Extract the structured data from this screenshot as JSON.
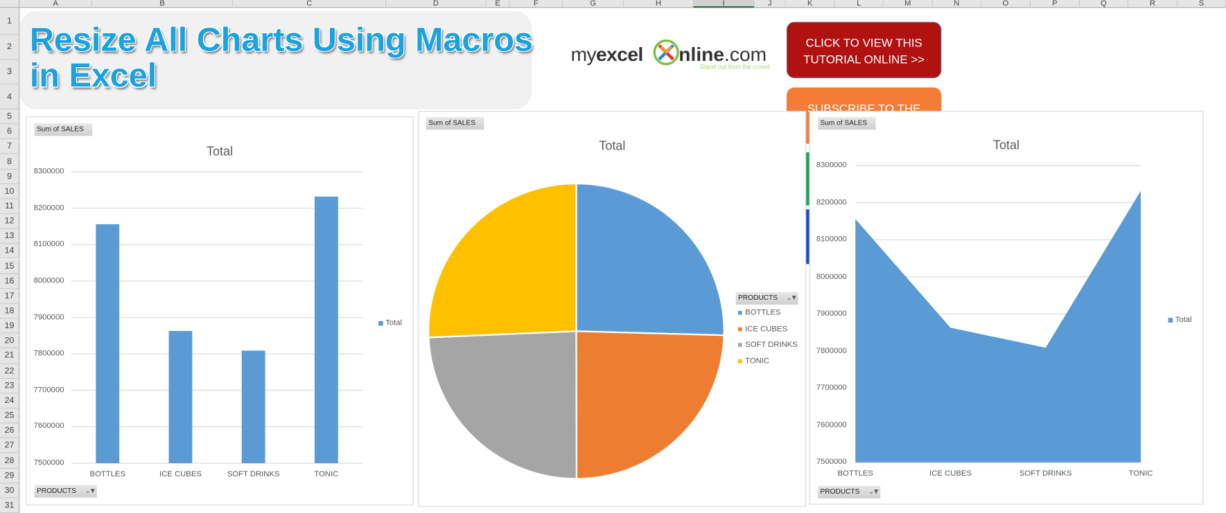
{
  "sheet": {
    "columns": [
      "A",
      "B",
      "C",
      "D",
      "E",
      "F",
      "G",
      "H",
      "I",
      "J",
      "K",
      "L",
      "M",
      "N",
      "O",
      "P",
      "Q",
      "R",
      "S"
    ],
    "selected_column": "I",
    "rows": [
      "1",
      "2",
      "3",
      "4",
      "5",
      "6",
      "7",
      "8",
      "9",
      "10",
      "11",
      "12",
      "13",
      "14",
      "15",
      "16",
      "17",
      "18",
      "19",
      "20",
      "21",
      "22",
      "23",
      "24",
      "25",
      "26",
      "27",
      "28",
      "29",
      "30",
      "31"
    ]
  },
  "banner": {
    "title_line1": "Resize All Charts Using Macros",
    "title_line2": "in Excel"
  },
  "logo": {
    "text_pre": "myexcel",
    "text_post": "nline.com",
    "tagline": "Stand out from the crowd"
  },
  "buttons": {
    "tutorial_line1": "CLICK TO VIEW THIS",
    "tutorial_line2": "TUTORIAL ONLINE >>",
    "subscribe": "SUBSCRIBE TO THE"
  },
  "colors": {
    "blue": "#5b9bd5",
    "orange": "#ed7d31",
    "gray": "#a5a5a5",
    "yellow": "#ffc000",
    "tutorial_button": "#b01212",
    "subscribe_button": "#f47c36"
  },
  "chart_data": [
    {
      "type": "bar",
      "field_button": "Sum of SALES",
      "axis_field_button": "PRODUCTS",
      "title": "Total",
      "categories": [
        "BOTTLES",
        "ICE CUBES",
        "SOFT DRINKS",
        "TONIC"
      ],
      "series": [
        {
          "name": "Total",
          "values": [
            8156000,
            7863000,
            7809000,
            8232000
          ]
        }
      ],
      "ylim": [
        7500000,
        8300000
      ],
      "yticks": [
        "7500000",
        "7600000",
        "7700000",
        "7800000",
        "7900000",
        "8000000",
        "8100000",
        "8200000",
        "8300000"
      ],
      "grid": true,
      "legend": "right"
    },
    {
      "type": "pie",
      "field_button": "Sum of SALES",
      "legend_field_button": "PRODUCTS",
      "title": "Total",
      "categories": [
        "BOTTLES",
        "ICE CUBES",
        "SOFT DRINKS",
        "TONIC"
      ],
      "values": [
        8156000,
        7863000,
        7809000,
        8232000
      ],
      "legend": "right"
    },
    {
      "type": "area",
      "field_button": "Sum of SALES",
      "axis_field_button": "PRODUCTS",
      "title": "Total",
      "categories": [
        "BOTTLES",
        "ICE CUBES",
        "SOFT DRINKS",
        "TONIC"
      ],
      "series": [
        {
          "name": "Total",
          "values": [
            8156000,
            7863000,
            7809000,
            8232000
          ]
        }
      ],
      "ylim": [
        7500000,
        8300000
      ],
      "yticks": [
        "7500000",
        "7600000",
        "7700000",
        "7800000",
        "7900000",
        "8000000",
        "8100000",
        "8200000",
        "8300000"
      ],
      "grid": true,
      "legend": "right"
    }
  ]
}
